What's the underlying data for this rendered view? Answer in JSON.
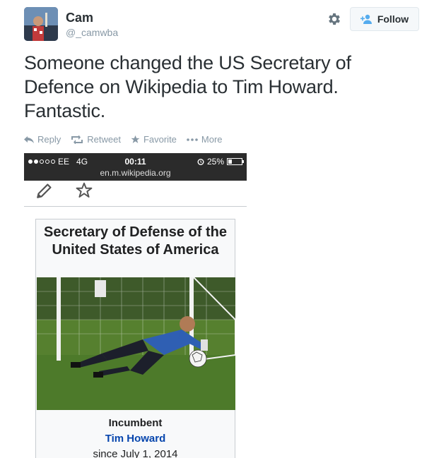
{
  "user": {
    "name": "Cam",
    "handle": "@_camwba"
  },
  "follow": {
    "label": "Follow"
  },
  "tweet": {
    "text": "Someone changed the US Secretary of Defence on Wikipedia to Tim Howard. Fantastic."
  },
  "actions": [
    {
      "label": "Reply",
      "icon": "reply-icon"
    },
    {
      "label": "Retweet",
      "icon": "retweet-icon"
    },
    {
      "label": "Favorite",
      "icon": "star-icon"
    },
    {
      "label": "More",
      "icon": "more-icon"
    }
  ],
  "screenshot": {
    "carrier": "EE",
    "network": "4G",
    "time": "00:11",
    "battery": "25%",
    "url": "en.m.wikipedia.org",
    "infobox": {
      "title": "Secretary of Defense of the United States of America",
      "incumbent_label": "Incumbent",
      "incumbent_name": "Tim Howard",
      "since": "since July 1, 2014"
    }
  },
  "colors": {
    "link": "#0645ad",
    "text": "#292f33",
    "muted": "#8899a6",
    "accent": "#55acee"
  }
}
